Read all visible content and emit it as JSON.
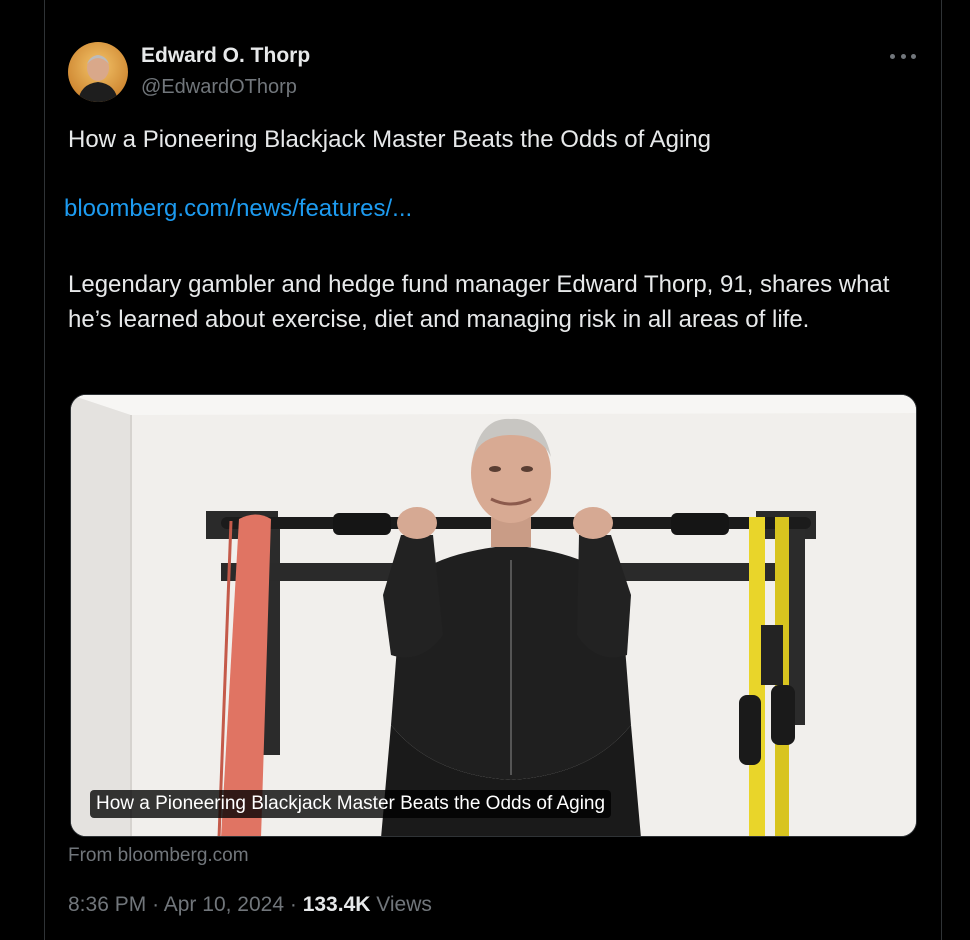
{
  "author": {
    "name": "Edward O. Thorp",
    "handle": "@EdwardOThorp"
  },
  "more_icon": "more-horizontal-icon",
  "tweet": {
    "headline": "How a Pioneering Blackjack Master Beats the Odds of Aging",
    "link_text": "bloomberg.com/news/features/...",
    "description": "Legendary gambler and hedge fund manager Edward Thorp, 91, shares what he’s learned about exercise, diet and managing risk in all areas of life."
  },
  "card": {
    "caption": "How a Pioneering Blackjack Master Beats the Odds of Aging",
    "source": "From bloomberg.com"
  },
  "meta": {
    "time": "8:36 PM",
    "separator": "·",
    "date": "Apr 10, 2024",
    "views_count": "133.4K",
    "views_label": "Views"
  },
  "colors": {
    "background": "#000000",
    "text": "#e7e9ea",
    "muted": "#71767b",
    "link": "#1d9bf0"
  }
}
